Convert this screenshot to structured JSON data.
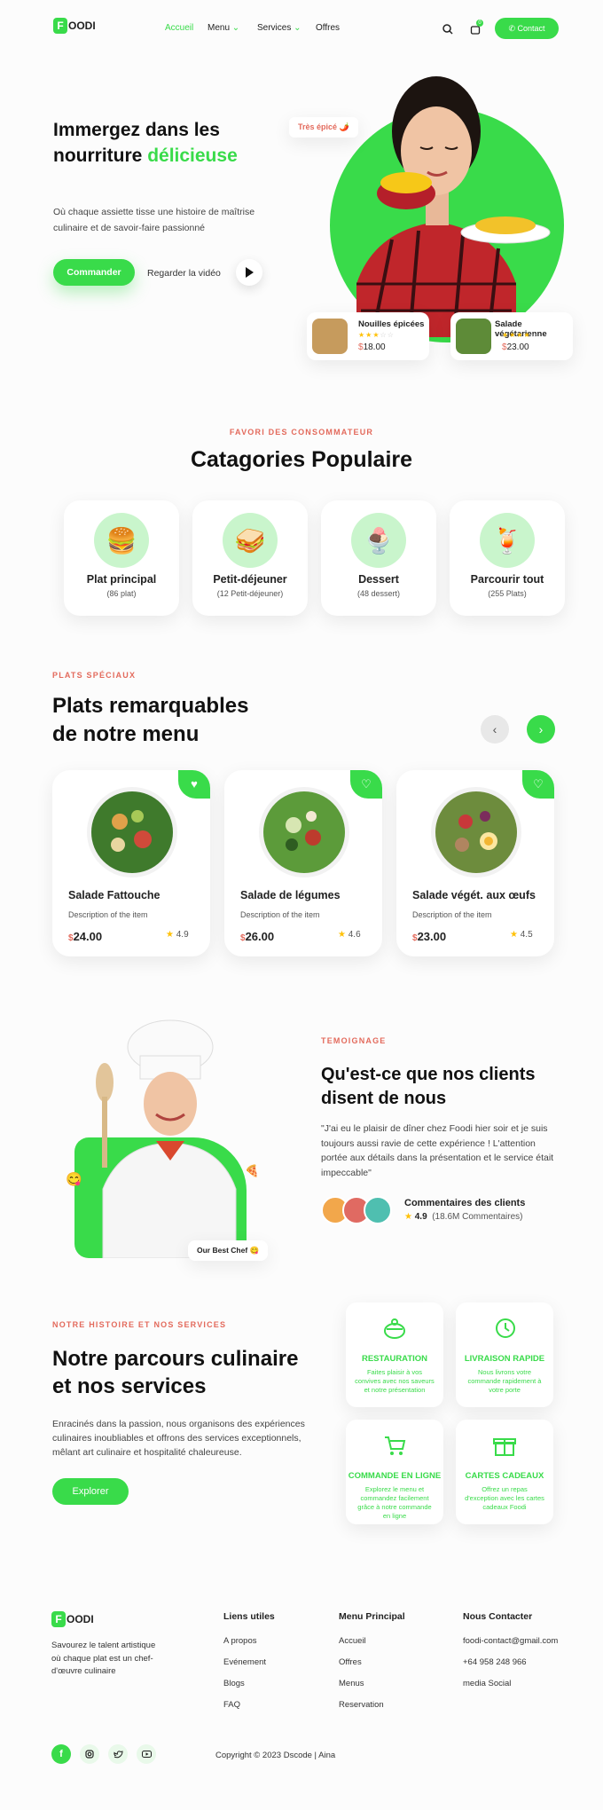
{
  "nav": {
    "logo_letter": "F",
    "logo_text": "OODI",
    "links": [
      "Accueil",
      "Menu",
      "Services",
      "Offres"
    ],
    "contact": "Contact",
    "cart_count": "0"
  },
  "hero": {
    "title_1": "Immergez dans les",
    "title_2": "nourriture",
    "title_accent": "délicieuse",
    "desc": "Où chaque assiette tisse une histoire de maîtrise culinaire et de savoir-faire passionné",
    "order": "Commander",
    "video": "Regarder la vidéo",
    "spicy": "Très épicé 🌶️",
    "cards": [
      {
        "name": "Nouilles épicées",
        "price": "18.00",
        "rating": 3
      },
      {
        "name": "Salade végétarienne",
        "price": "23.00",
        "rating": 4
      }
    ]
  },
  "categories": {
    "sub": "FAVORI DES CONSOMMATEUR",
    "title": "Catagories Populaire",
    "items": [
      {
        "name": "Plat principal",
        "count": "(86 plat)",
        "icon": "🍔"
      },
      {
        "name": "Petit-déjeuner",
        "count": "(12 Petit-déjeuner)",
        "icon": "🥪"
      },
      {
        "name": "Dessert",
        "count": "(48 dessert)",
        "icon": "🍨"
      },
      {
        "name": "Parcourir tout",
        "count": "(255 Plats)",
        "icon": "🍹"
      }
    ]
  },
  "specials": {
    "sub": "PLATS SPÉCIAUX",
    "title_1": "Plats remarquables",
    "title_2": "de notre menu",
    "items": [
      {
        "name": "Salade Fattouche",
        "desc": "Description of the item",
        "price": "24.00",
        "rating": "4.9"
      },
      {
        "name": "Salade de légumes",
        "desc": "Description of the item",
        "price": "26.00",
        "rating": "4.6"
      },
      {
        "name": "Salade végét. aux œufs",
        "desc": "Description of the item",
        "price": "23.00",
        "rating": "4.5"
      }
    ]
  },
  "testimonial": {
    "sub": "TEMOIGNAGE",
    "title_1": "Qu'est-ce que nos clients",
    "title_2": "disent de nous",
    "quote": "\"J'ai eu le plaisir de dîner chez Foodi hier soir et je suis toujours aussi ravie de cette expérience ! L'attention portée aux détails dans la présentation et le service était impeccable\"",
    "reviews_title": "Commentaires des clients",
    "rating": "4.9",
    "count": "(18.6M Commentaires)",
    "chef_badge": "Our Best Chef 😋"
  },
  "services": {
    "sub": "NOTRE HISTOIRE ET NOS SERVICES",
    "title_1": "Notre parcours culinaire",
    "title_2": "et nos services",
    "desc": "Enracinés dans la passion, nous organisons des expériences culinaires inoubliables et offrons des services exceptionnels, mêlant art culinaire et hospitalité chaleureuse.",
    "explore": "Explorer",
    "items": [
      {
        "title": "RESTAURATION",
        "desc": "Faites plaisir à vos convives avec nos saveurs et notre présentation"
      },
      {
        "title": "LIVRAISON RAPIDE",
        "desc": "Nous livrons votre commande rapidement à votre porte"
      },
      {
        "title": "COMMANDE EN LIGNE",
        "desc": "Explorez le menu et commandez facilement grâce à notre commande en ligne"
      },
      {
        "title": "CARTES CADEAUX",
        "desc": "Offrez un repas d'exception avec les cartes cadeaux Foodi"
      }
    ]
  },
  "footer": {
    "about": "Savourez le talent artistique où chaque plat est un chef-d'œuvre culinaire",
    "cols": [
      {
        "title": "Liens utiles",
        "links": [
          "A propos",
          "Evénement",
          "Blogs",
          "FAQ"
        ]
      },
      {
        "title": "Menu Principal",
        "links": [
          "Accueil",
          "Offres",
          "Menus",
          "Reservation"
        ]
      },
      {
        "title": "Nous Contacter",
        "links": [
          "foodi-contact@gmail.com",
          "+64 958 248 966",
          "media  Social"
        ]
      }
    ],
    "copyright": "Copyright  ©  2023 Dscode | Aina"
  },
  "colors": {
    "accent": "#39db4a",
    "sub": "#e36a5c"
  }
}
